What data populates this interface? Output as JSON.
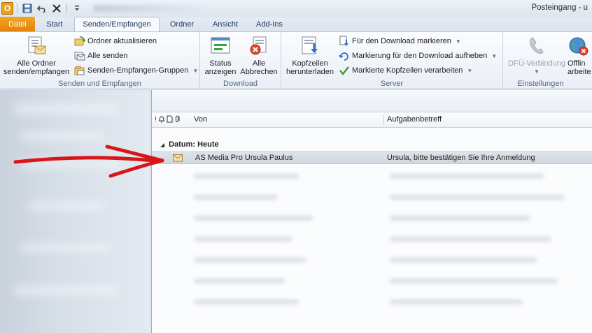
{
  "window": {
    "title": "Posteingang - u"
  },
  "qat": {
    "app_icon": "outlook-logo"
  },
  "tabs": [
    {
      "label": "Datei"
    },
    {
      "label": "Start"
    },
    {
      "label": "Senden/Empfangen"
    },
    {
      "label": "Ordner"
    },
    {
      "label": "Ansicht"
    },
    {
      "label": "Add-Ins"
    }
  ],
  "ribbon": {
    "send_receive_group": {
      "label": "Senden und Empfangen",
      "all_folders_line1": "Alle Ordner",
      "all_folders_line2": "senden/empfangen",
      "update_folder": "Ordner aktualisieren",
      "send_all": "Alle senden",
      "groups": "Senden-Empfangen-Gruppen"
    },
    "download_group": {
      "label": "Download",
      "status_line1": "Status",
      "status_line2": "anzeigen",
      "cancel_line1": "Alle",
      "cancel_line2": "Abbrechen"
    },
    "server_group": {
      "label": "Server",
      "headers_line1": "Kopfzeilen",
      "headers_line2": "herunterladen",
      "mark_download": "Für den Download markieren",
      "unmark_download": "Markierung für den Download aufheben",
      "process_headers": "Markierte Kopfzeilen verarbeiten"
    },
    "settings_group": {
      "label": "Einstellungen",
      "dialup": "DFÜ-Verbindung",
      "offline_line1": "Offlin",
      "offline_line2": "arbeite"
    }
  },
  "list": {
    "columns": {
      "from": "Von",
      "subject": "Aufgabenbetreff"
    },
    "group_header": "Datum: Heute",
    "rows": [
      {
        "from": "AS Media Pro Ursula Paulus",
        "subject": "Ursula, bitte bestätigen Sie Ihre Anmeldung"
      }
    ]
  },
  "colors": {
    "accent_file_tab": "#e2820a",
    "annotation_arrow": "#d8161a"
  }
}
